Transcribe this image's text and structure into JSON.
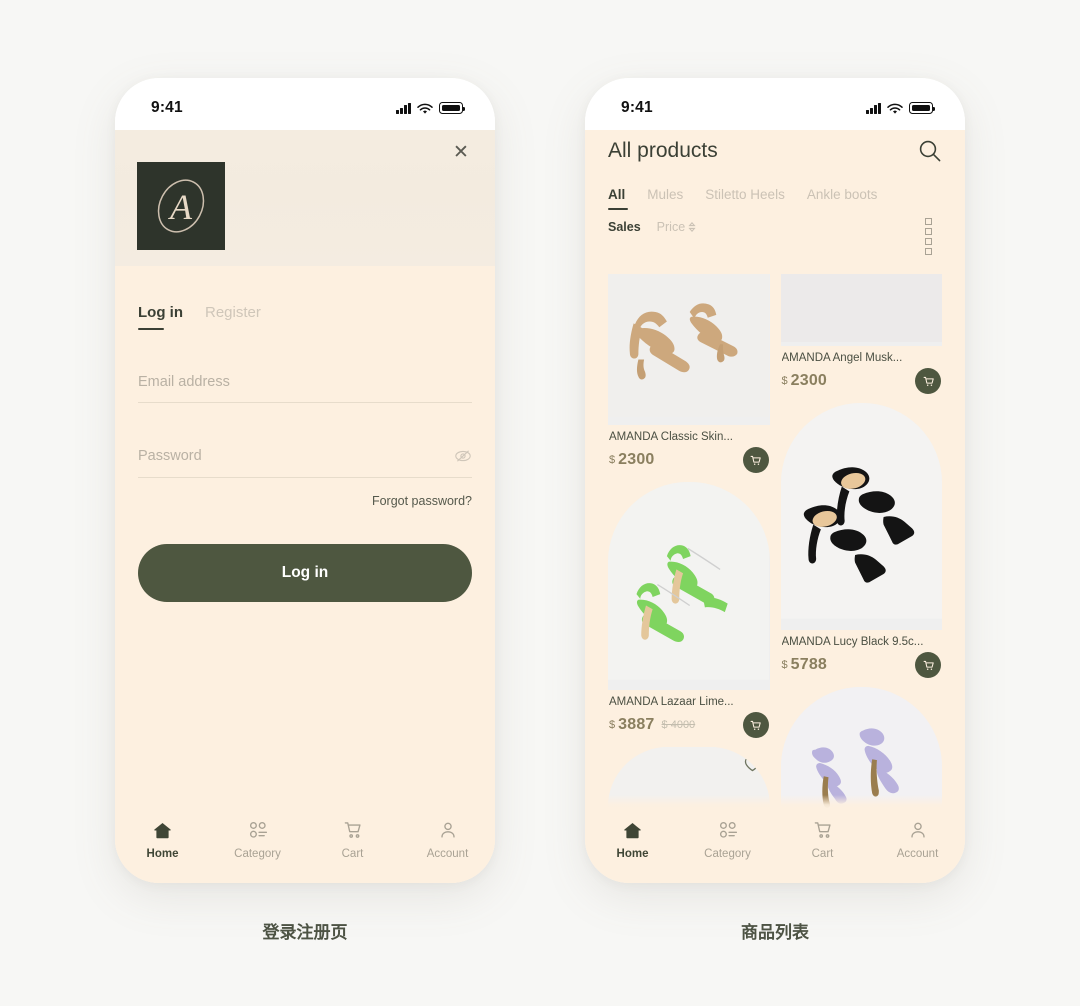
{
  "status_bar": {
    "time": "9:41",
    "icons": [
      "signal-icon",
      "wifi-icon",
      "battery-icon"
    ]
  },
  "colors": {
    "accent_green": "#4e5740",
    "logo_tile": "#2e342b",
    "screen_bg": "#fdf0e0",
    "hero_band": "#f3ebdf",
    "price_text": "#8a7f5f",
    "muted_text": "#cbc2b5"
  },
  "login_screen": {
    "caption": "登录注册页",
    "close_label": "✕",
    "logo_letter": "A",
    "tabs": [
      {
        "label": "Log in",
        "active": true
      },
      {
        "label": "Register",
        "active": false
      }
    ],
    "fields": {
      "email": {
        "placeholder": "Email address",
        "value": ""
      },
      "password": {
        "placeholder": "Password",
        "value": ""
      }
    },
    "forgot_label": "Forgot password?",
    "submit_label": "Log in"
  },
  "list_screen": {
    "caption": "商品列表",
    "title": "All products",
    "search_icon": "search-icon",
    "category_tabs": [
      {
        "label": "All",
        "active": true
      },
      {
        "label": "Mules",
        "active": false
      },
      {
        "label": "Stiletto Heels",
        "active": false
      },
      {
        "label": "Ankle boots",
        "active": false
      }
    ],
    "sort_options": [
      {
        "label": "Sales",
        "active": true,
        "has_chevron": false
      },
      {
        "label": "Price",
        "active": false,
        "has_chevron": true
      }
    ],
    "grid_toggle_icon": "grid-view-icon",
    "products": [
      {
        "name": "AMANDA Classic Skin...",
        "currency": "$",
        "price": "2300",
        "old_price": "",
        "column": "left",
        "shape": "flat",
        "favorited": false,
        "image_alt": "tan-strappy-heeled-sandals"
      },
      {
        "name": "AMANDA Angel Musk...",
        "currency": "$",
        "price": "2300",
        "old_price": "",
        "column": "right",
        "shape": "flat",
        "favorited": false,
        "image_alt": "light-gray-product-photo"
      },
      {
        "name": "AMANDA Lazaar Lime...",
        "currency": "$",
        "price": "3887",
        "old_price": "$ 4000",
        "column": "left",
        "shape": "arch",
        "favorited": false,
        "image_alt": "green-strappy-stiletto-sandals"
      },
      {
        "name": "AMANDA Lucy Black 9.5c...",
        "currency": "$",
        "price": "5788",
        "old_price": "",
        "column": "right",
        "shape": "arch",
        "favorited": false,
        "image_alt": "black-padded-mule-heels"
      },
      {
        "name": "",
        "currency": "",
        "price": "",
        "old_price": "",
        "column": "left",
        "shape": "arch",
        "favorited": false,
        "image_alt": "partially-visible-product"
      },
      {
        "name": "",
        "currency": "",
        "price": "",
        "old_price": "",
        "column": "right",
        "shape": "arch",
        "favorited": false,
        "image_alt": "lavender-strappy-heels"
      }
    ]
  },
  "tabbar": {
    "items": [
      {
        "label": "Home",
        "icon": "home-icon",
        "active": true
      },
      {
        "label": "Category",
        "icon": "category-grid-icon",
        "active": false
      },
      {
        "label": "Cart",
        "icon": "cart-icon",
        "active": false
      },
      {
        "label": "Account",
        "icon": "person-icon",
        "active": false
      }
    ]
  }
}
